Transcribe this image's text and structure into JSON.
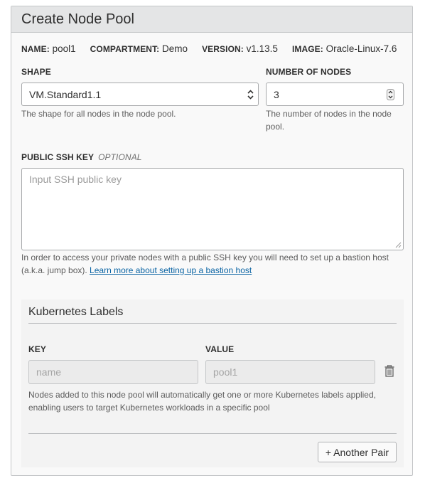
{
  "panel": {
    "title": "Create Node Pool"
  },
  "meta": [
    {
      "key": "NAME:",
      "value": "pool1"
    },
    {
      "key": "COMPARTMENT:",
      "value": "Demo"
    },
    {
      "key": "VERSION:",
      "value": "v1.13.5"
    },
    {
      "key": "IMAGE:",
      "value": "Oracle-Linux-7.6"
    }
  ],
  "shape": {
    "label": "SHAPE",
    "value": "VM.Standard1.1",
    "help": "The shape for all nodes in the node pool."
  },
  "nodes": {
    "label": "NUMBER OF NODES",
    "value": "3",
    "help": "The number of nodes in the node pool."
  },
  "ssh": {
    "label": "PUBLIC SSH KEY",
    "optional": "OPTIONAL",
    "placeholder": "Input SSH public key",
    "help": "In order to access your private nodes with a public SSH key you will need to set up a bastion host (a.k.a. jump box).",
    "link": "Learn more about setting up a bastion host"
  },
  "kubernetes": {
    "title": "Kubernetes Labels",
    "key_label": "KEY",
    "value_label": "VALUE",
    "key_value": "name",
    "value_value": "pool1",
    "help": "Nodes added to this node pool will automatically get one or more Kubernetes labels applied, enabling users to target Kubernetes workloads in a specific pool",
    "add_button": "+ Another Pair",
    "delete_icon": "trash-icon"
  }
}
